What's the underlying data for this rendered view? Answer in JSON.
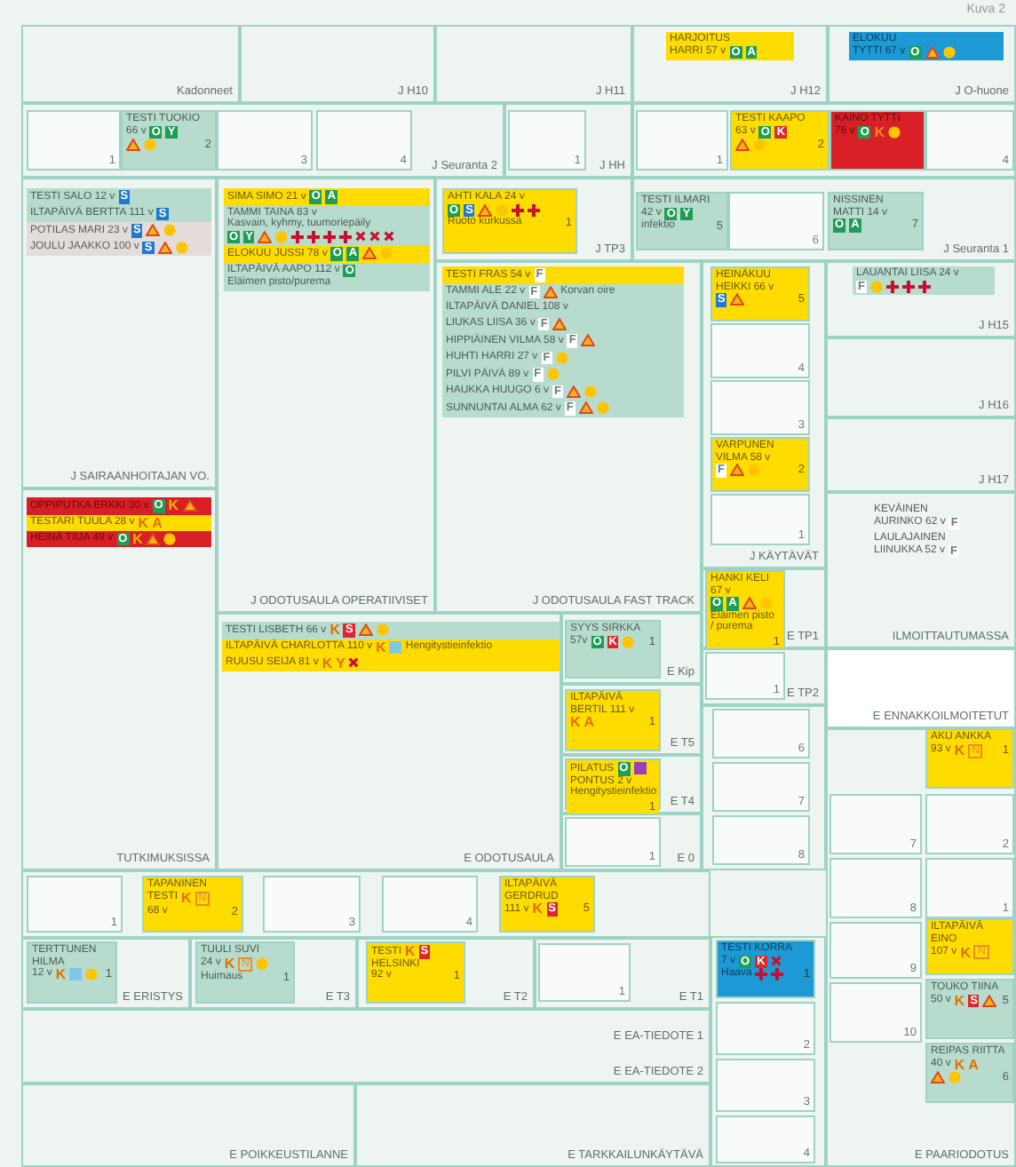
{
  "caption": "Kuva 2",
  "rooms": [
    {
      "label": "Kadonneet"
    },
    {
      "label": "J H10"
    },
    {
      "label": "J H11"
    },
    {
      "label": "J H12",
      "patients": [
        {
          "color": "#ffdc00",
          "lines": [
            [
              {
                "kind": "text",
                "text": "HARJOITUS"
              }
            ],
            [
              {
                "kind": "text",
                "text": "HARRI 57 v"
              },
              {
                "kind": "tag",
                "text": "O",
                "color": "#1f9d55"
              },
              {
                "kind": "tag",
                "text": "A",
                "color": "#1f9d55"
              }
            ]
          ]
        }
      ]
    },
    {
      "label": "J O-huone",
      "patients": [
        {
          "color": "#1d9ad6",
          "lines": [
            [
              {
                "kind": "text",
                "text": "ELOKUU"
              }
            ],
            [
              {
                "kind": "text",
                "text": "TYTTI 67 v"
              },
              {
                "kind": "tag",
                "text": "O",
                "color": "#1f9d55"
              },
              {
                "kind": "warning"
              },
              {
                "kind": "dot"
              }
            ]
          ]
        }
      ]
    },
    {
      "label": "J Seuranta 2",
      "beds": [
        {
          "number": "1"
        },
        {
          "number": "2",
          "patient": {
            "color": "#b7dccd",
            "lines": [
              [
                {
                  "kind": "text",
                  "text": "TESTI TUOKIO"
                }
              ],
              [
                {
                  "kind": "text",
                  "text": "66 v"
                },
                {
                  "kind": "tag",
                  "text": "O",
                  "color": "#1f9d55"
                },
                {
                  "kind": "tag",
                  "text": "Y",
                  "color": "#1f9d55"
                }
              ],
              [
                {
                  "kind": "warning"
                },
                {
                  "kind": "dot"
                }
              ]
            ]
          }
        },
        {
          "number": "3"
        },
        {
          "number": "4"
        }
      ]
    },
    {
      "label": "J HH",
      "beds": [
        {
          "number": "1"
        }
      ]
    },
    {
      "beds": [
        {
          "number": "1"
        },
        {
          "number": "2",
          "patient": {
            "color": "#ffdc00",
            "lines": [
              [
                {
                  "kind": "text",
                  "text": "TESTI KAAPO"
                }
              ],
              [
                {
                  "kind": "text",
                  "text": "63 v"
                },
                {
                  "kind": "tag",
                  "text": "O",
                  "color": "#1f9d55"
                },
                {
                  "kind": "tag",
                  "text": "K",
                  "color": "#e0262b"
                }
              ],
              [
                {
                  "kind": "warning"
                },
                {
                  "kind": "dot"
                }
              ]
            ]
          }
        },
        {
          "patient": {
            "color": "#d91f26",
            "lines": [
              [
                {
                  "kind": "text",
                  "text": "KAINO TYTTI"
                }
              ],
              [
                {
                  "kind": "text",
                  "text": "76 v"
                },
                {
                  "kind": "tag",
                  "text": "O",
                  "color": "#1f9d55"
                },
                {
                  "kind": "letter",
                  "text": "K",
                  "color": "#f08a24"
                },
                {
                  "kind": "dot"
                }
              ]
            ]
          }
        },
        {
          "number": "4"
        }
      ]
    },
    {
      "label": "J SAIRAANHOITAJAN VO.",
      "patients": [
        {
          "color": "#b7dccd",
          "lines": [
            [
              {
                "kind": "text",
                "text": "TESTI SALO 12 v"
              },
              {
                "kind": "tag",
                "text": "S",
                "color": "#1f78d1"
              }
            ]
          ]
        },
        {
          "color": "#b7dccd",
          "lines": [
            [
              {
                "kind": "text",
                "text": "ILTAPÄIVÄ BERTTA 111 v"
              },
              {
                "kind": "tag",
                "text": "S",
                "color": "#1f78d1"
              }
            ]
          ]
        },
        {
          "color": "#e4dcd9",
          "lines": [
            [
              {
                "kind": "text",
                "text": "POTILAS MARI 23 v"
              },
              {
                "kind": "tag",
                "text": "S",
                "color": "#1f78d1"
              },
              {
                "kind": "warning"
              },
              {
                "kind": "dot"
              }
            ]
          ]
        },
        {
          "color": "#e4dcd9",
          "lines": [
            [
              {
                "kind": "text",
                "text": "JOULU JAAKKO 100 v"
              },
              {
                "kind": "tag",
                "text": "S",
                "color": "#1f78d1"
              },
              {
                "kind": "warning"
              },
              {
                "kind": "dot"
              }
            ]
          ]
        }
      ]
    },
    {
      "label": "J ODOTUSAULA OPERATIIVISET",
      "patients": [
        {
          "color": "#ffdc00",
          "lines": [
            [
              {
                "kind": "text",
                "text": "SIMA SIMO 21 v"
              },
              {
                "kind": "tag",
                "text": "O",
                "color": "#1f9d55"
              },
              {
                "kind": "tag",
                "text": "A",
                "color": "#1f9d55"
              }
            ]
          ]
        },
        {
          "color": "#b7dccd",
          "lines": [
            [
              {
                "kind": "text",
                "text": "TAMMI TAINA 83 v"
              }
            ],
            [
              {
                "kind": "text",
                "text": "Kasvain, kyhmy, tuumoriepäily"
              }
            ],
            [
              {
                "kind": "tag",
                "text": "O",
                "color": "#1f9d55"
              },
              {
                "kind": "tag",
                "text": "Y",
                "color": "#1f9d55"
              },
              {
                "kind": "warning"
              },
              {
                "kind": "dot"
              },
              {
                "kind": "cross"
              },
              {
                "kind": "cross"
              },
              {
                "kind": "cross"
              },
              {
                "kind": "cross"
              },
              {
                "kind": "x"
              },
              {
                "kind": "x"
              },
              {
                "kind": "x"
              }
            ]
          ]
        },
        {
          "color": "#ffdc00",
          "lines": [
            [
              {
                "kind": "text",
                "text": "ELOKUU JUSSI 78 v"
              },
              {
                "kind": "tag",
                "text": "O",
                "color": "#1f9d55"
              },
              {
                "kind": "tag",
                "text": "A",
                "color": "#1f9d55"
              },
              {
                "kind": "warning"
              },
              {
                "kind": "dot"
              }
            ]
          ]
        },
        {
          "color": "#b7dccd",
          "lines": [
            [
              {
                "kind": "text",
                "text": "ILTAPÄIVÄ AAPO 112 v"
              },
              {
                "kind": "tag",
                "text": "O",
                "color": "#1f9d55"
              }
            ],
            [
              {
                "kind": "text",
                "text": "Eläimen pisto/purema"
              }
            ]
          ]
        }
      ]
    },
    {
      "label": "J TP3",
      "beds": [
        {
          "number": "1",
          "patient": {
            "color": "#ffdc00",
            "lines": [
              [
                {
                  "kind": "text",
                  "text": "AHTI KALA 24 v"
                }
              ],
              [
                {
                  "kind": "tag",
                  "text": "O",
                  "color": "#1f9d55"
                },
                {
                  "kind": "tag",
                  "text": "S",
                  "color": "#1f78d1"
                },
                {
                  "kind": "warning"
                },
                {
                  "kind": "dot"
                },
                {
                  "kind": "cross"
                },
                {
                  "kind": "cross"
                }
              ],
              [
                {
                  "kind": "text",
                  "text": "Ruoto kurkussa"
                }
              ]
            ]
          }
        }
      ]
    },
    {
      "label": "J Seuranta 1",
      "beds": [
        {
          "number": "5",
          "patient": {
            "color": "#b7dccd",
            "lines": [
              [
                {
                  "kind": "text",
                  "text": "TESTI ILMARI"
                }
              ],
              [
                {
                  "kind": "text",
                  "text": "42 v"
                },
                {
                  "kind": "tag",
                  "text": "O",
                  "color": "#1f9d55"
                },
                {
                  "kind": "tag",
                  "text": "Y",
                  "color": "#1f9d55"
                }
              ],
              [
                {
                  "kind": "text",
                  "text": "infektio"
                }
              ]
            ]
          }
        },
        {
          "number": "6"
        },
        {
          "number": "7",
          "patient": {
            "color": "#b7dccd",
            "lines": [
              [
                {
                  "kind": "text",
                  "text": "NISSINEN"
                }
              ],
              [
                {
                  "kind": "text",
                  "text": "MATTI 14 v"
                }
              ],
              [
                {
                  "kind": "tag",
                  "text": "O",
                  "color": "#1f9d55"
                },
                {
                  "kind": "tag",
                  "text": "A",
                  "color": "#1f9d55"
                }
              ]
            ]
          }
        }
      ]
    },
    {
      "label": "J ODOTUSAULA FAST TRACK",
      "patients": [
        {
          "color": "#ffdc00",
          "lines": [
            [
              {
                "kind": "text",
                "text": "TESTI FRAS 54 v"
              },
              {
                "kind": "tag",
                "text": "F",
                "color": "#ffffff"
              }
            ]
          ]
        },
        {
          "color": "#b7dccd",
          "lines": [
            [
              {
                "kind": "text",
                "text": "TAMMI ALE 22 v"
              },
              {
                "kind": "tag",
                "text": "F",
                "color": "#ffffff"
              },
              {
                "kind": "warning"
              },
              {
                "kind": "text",
                "text": "Korvan oire"
              }
            ]
          ]
        },
        {
          "color": "#b7dccd",
          "lines": [
            [
              {
                "kind": "text",
                "text": "ILTAPÄIVÄ DANIEL 108 v"
              }
            ]
          ]
        },
        {
          "color": "#b7dccd",
          "lines": [
            [
              {
                "kind": "text",
                "text": "LIUKAS LIISA 36 v"
              },
              {
                "kind": "tag",
                "text": "F",
                "color": "#ffffff"
              },
              {
                "kind": "warning"
              }
            ]
          ]
        },
        {
          "color": "#b7dccd",
          "lines": [
            [
              {
                "kind": "text",
                "text": "HIPPIÄINEN VILMA 58 v"
              },
              {
                "kind": "tag",
                "text": "F",
                "color": "#ffffff"
              },
              {
                "kind": "warning"
              }
            ]
          ]
        },
        {
          "color": "#b7dccd",
          "lines": [
            [
              {
                "kind": "text",
                "text": "HUHTI HARRI 27 v"
              },
              {
                "kind": "tag",
                "text": "F",
                "color": "#ffffff"
              },
              {
                "kind": "dot"
              }
            ]
          ]
        },
        {
          "color": "#b7dccd",
          "lines": [
            [
              {
                "kind": "text",
                "text": "PILVI PÄIVÄ 89 v"
              },
              {
                "kind": "tag",
                "text": "F",
                "color": "#ffffff"
              },
              {
                "kind": "dot"
              }
            ]
          ]
        },
        {
          "color": "#b7dccd",
          "lines": [
            [
              {
                "kind": "text",
                "text": "HAUKKA HUUGO 6 v"
              },
              {
                "kind": "tag",
                "text": "F",
                "color": "#ffffff"
              },
              {
                "kind": "warning"
              },
              {
                "kind": "dot"
              }
            ]
          ]
        },
        {
          "color": "#b7dccd",
          "lines": [
            [
              {
                "kind": "text",
                "text": "SUNNUNTAI ALMA 62 v"
              },
              {
                "kind": "tag",
                "text": "F",
                "color": "#ffffff"
              },
              {
                "kind": "warning"
              },
              {
                "kind": "dot"
              }
            ]
          ]
        }
      ]
    },
    {
      "label": "J KÄYTÄVÄT",
      "beds": [
        {
          "number": "5",
          "patient": {
            "color": "#ffdc00",
            "lines": [
              [
                {
                  "kind": "text",
                  "text": "HEINÄKUU"
                }
              ],
              [
                {
                  "kind": "text",
                  "text": "HEIKKI 66 v"
                }
              ],
              [
                {
                  "kind": "tag",
                  "text": "S",
                  "color": "#1f78d1"
                },
                {
                  "kind": "warning"
                }
              ]
            ]
          }
        },
        {
          "number": "4"
        },
        {
          "number": "3"
        },
        {
          "number": "2",
          "patient": {
            "color": "#ffdc00",
            "lines": [
              [
                {
                  "kind": "text",
                  "text": "VARPUNEN"
                }
              ],
              [
                {
                  "kind": "text",
                  "text": "VILMA 58 v"
                }
              ],
              [
                {
                  "kind": "tag",
                  "text": "F",
                  "color": "#ffffff"
                },
                {
                  "kind": "warning"
                },
                {
                  "kind": "dot"
                }
              ]
            ]
          }
        },
        {
          "number": "1"
        }
      ]
    },
    {
      "label": "J H15",
      "patients": [
        {
          "color": "#b7dccd",
          "lines": [
            [
              {
                "kind": "text",
                "text": "LAUANTAI LIISA 24 v"
              }
            ],
            [
              {
                "kind": "tag",
                "text": "F",
                "color": "#ffffff"
              },
              {
                "kind": "dot"
              },
              {
                "kind": "cross"
              },
              {
                "kind": "cross"
              },
              {
                "kind": "cross"
              }
            ]
          ]
        }
      ]
    },
    {
      "label": "J H16"
    },
    {
      "label": "J H17"
    },
    {
      "label": "ILMOITTAUTUMASSA",
      "patients": [
        {
          "lines": [
            [
              {
                "kind": "text",
                "text": "KEVÄINEN"
              }
            ],
            [
              {
                "kind": "text",
                "text": "AURINKO 62 v"
              },
              {
                "kind": "tag",
                "text": "F",
                "color": "#ffffff"
              }
            ]
          ]
        },
        {
          "lines": [
            [
              {
                "kind": "text",
                "text": "LAULAJAINEN"
              }
            ],
            [
              {
                "kind": "text",
                "text": "LIINUKKA 52 v"
              },
              {
                "kind": "tag",
                "text": "F",
                "color": "#ffffff"
              }
            ]
          ]
        }
      ]
    },
    {
      "label": "E ENNAKKOILMOITETUT"
    },
    {
      "label": "TUTKIMUKSISSA",
      "patients": [
        {
          "color": "#d91f26",
          "lines": [
            [
              {
                "kind": "text",
                "text": "OPPIPUTKA ERKKI 30 v"
              },
              {
                "kind": "tag",
                "text": "O",
                "color": "#1f9d55"
              },
              {
                "kind": "letter",
                "text": "K",
                "color": "#f0b400"
              },
              {
                "kind": "warning"
              }
            ]
          ]
        },
        {
          "color": "#ffdc00",
          "lines": [
            [
              {
                "kind": "text",
                "text": "TESTARI TUULA 28 v"
              },
              {
                "kind": "letter",
                "text": "K",
                "color": "#e07000"
              },
              {
                "kind": "letter",
                "text": "A",
                "color": "#e07000"
              }
            ]
          ]
        },
        {
          "color": "#d91f26",
          "lines": [
            [
              {
                "kind": "text",
                "text": "HEINÄ TIIJA 49 v"
              },
              {
                "kind": "tag",
                "text": "O",
                "color": "#1f9d55"
              },
              {
                "kind": "letter",
                "text": "K",
                "color": "#f0b400"
              },
              {
                "kind": "warning"
              },
              {
                "kind": "dot"
              }
            ]
          ]
        }
      ]
    },
    {
      "label": "E ODOTUSAULA",
      "patients": [
        {
          "color": "#b7dccd",
          "lines": [
            [
              {
                "kind": "text",
                "text": "TESTI LISBETH 66 v"
              },
              {
                "kind": "letter",
                "text": "K",
                "color": "#e07000"
              },
              {
                "kind": "tag",
                "text": "S",
                "color": "#e0262b"
              },
              {
                "kind": "warning"
              },
              {
                "kind": "dot"
              }
            ]
          ]
        },
        {
          "color": "#ffdc00",
          "lines": [
            [
              {
                "kind": "text",
                "text": "ILTAPÄIVÄ CHARLOTTA 110 v"
              },
              {
                "kind": "letter",
                "text": "K",
                "color": "#e07000"
              },
              {
                "kind": "square",
                "color": "#7fc8e8"
              },
              {
                "kind": "text",
                "text": "Hengitystieinfektio"
              }
            ]
          ]
        },
        {
          "color": "#ffdc00",
          "lines": [
            [
              {
                "kind": "text",
                "text": "RUUSU SEIJA 81 v"
              },
              {
                "kind": "letter",
                "text": "K",
                "color": "#e07000"
              },
              {
                "kind": "letter",
                "text": "Y",
                "color": "#e07000"
              },
              {
                "kind": "x"
              }
            ]
          ]
        }
      ]
    },
    {
      "label": "E Kip",
      "beds": [
        {
          "number": "1",
          "patient": {
            "color": "#b7dccd",
            "lines": [
              [
                {
                  "kind": "text",
                  "text": "SYYS SIRKKA"
                }
              ],
              [
                {
                  "kind": "text",
                  "text": "57v"
                },
                {
                  "kind": "tag",
                  "text": "O",
                  "color": "#1f9d55"
                },
                {
                  "kind": "tag",
                  "text": "K",
                  "color": "#e0262b"
                },
                {
                  "kind": "dot"
                }
              ]
            ]
          }
        }
      ]
    },
    {
      "label": "E T5",
      "beds": [
        {
          "number": "1",
          "patient": {
            "color": "#ffdc00",
            "lines": [
              [
                {
                  "kind": "text",
                  "text": "ILTAPÄIVÄ"
                }
              ],
              [
                {
                  "kind": "text",
                  "text": "BERTIL 111 v"
                }
              ],
              [
                {
                  "kind": "letter",
                  "text": "K",
                  "color": "#e07000"
                },
                {
                  "kind": "letter",
                  "text": "A",
                  "color": "#e07000"
                }
              ]
            ]
          }
        }
      ]
    },
    {
      "label": "E T4",
      "beds": [
        {
          "number": "1",
          "patient": {
            "color": "#ffdc00",
            "lines": [
              [
                {
                  "kind": "text",
                  "text": "PILATUS"
                },
                {
                  "kind": "tag",
                  "text": "O",
                  "color": "#1f9d55"
                },
                {
                  "kind": "square",
                  "color": "#9b3fb5"
                }
              ],
              [
                {
                  "kind": "text",
                  "text": "PONTUS 2 v"
                }
              ],
              [
                {
                  "kind": "text",
                  "text": "Hengitystieinfektio"
                }
              ]
            ]
          }
        }
      ]
    },
    {
      "label": "E 0",
      "beds": [
        {
          "number": "1"
        }
      ]
    },
    {
      "label": "E TP1",
      "beds": [
        {
          "number": "1",
          "patient": {
            "color": "#ffdc00",
            "lines": [
              [
                {
                  "kind": "text",
                  "text": "HANKI KELI 67 v"
                }
              ],
              [
                {
                  "kind": "tag",
                  "text": "O",
                  "color": "#1f9d55"
                },
                {
                  "kind": "tag",
                  "text": "A",
                  "color": "#1f9d55"
                },
                {
                  "kind": "warning"
                },
                {
                  "kind": "dot"
                }
              ],
              [
                {
                  "kind": "text",
                  "text": "Eläimen pisto / purema"
                }
              ]
            ]
          }
        }
      ]
    },
    {
      "label": "E TP2",
      "beds": [
        {
          "number": "1"
        }
      ]
    },
    {
      "beds": [
        {
          "number": "6"
        },
        {
          "number": "7"
        },
        {
          "number": "8"
        }
      ]
    },
    {
      "beds": [
        {
          "number": "1"
        },
        {
          "number": "2",
          "patient": {
            "color": "#ffdc00",
            "lines": [
              [
                {
                  "kind": "text",
                  "text": "TAPANINEN"
                }
              ],
              [
                {
                  "kind": "text",
                  "text": "TESTI"
                },
                {
                  "kind": "letter",
                  "text": "K",
                  "color": "#e07000"
                },
                {
                  "kind": "outline",
                  "text": "N",
                  "color": "#f08a24"
                }
              ],
              [
                {
                  "kind": "text",
                  "text": "68 v"
                }
              ]
            ]
          }
        },
        {
          "number": "3"
        },
        {
          "number": "4"
        },
        {
          "number": "5",
          "patient": {
            "color": "#ffdc00",
            "lines": [
              [
                {
                  "kind": "text",
                  "text": "ILTAPÄIVÄ"
                }
              ],
              [
                {
                  "kind": "text",
                  "text": "GERDRUD"
                }
              ],
              [
                {
                  "kind": "text",
                  "text": "111 v"
                },
                {
                  "kind": "letter",
                  "text": "K",
                  "color": "#e07000"
                },
                {
                  "kind": "tag",
                  "text": "S",
                  "color": "#e0262b"
                }
              ]
            ]
          }
        }
      ]
    },
    {
      "label": "E ERISTYS",
      "beds": [
        {
          "number": "1",
          "patient": {
            "color": "#b7dccd",
            "lines": [
              [
                {
                  "kind": "text",
                  "text": "TERTTUNEN"
                }
              ],
              [
                {
                  "kind": "text",
                  "text": "HILMA"
                }
              ],
              [
                {
                  "kind": "text",
                  "text": "12 v"
                },
                {
                  "kind": "letter",
                  "text": "K",
                  "color": "#e07000"
                },
                {
                  "kind": "square",
                  "color": "#7fc8e8"
                },
                {
                  "kind": "dot"
                }
              ]
            ]
          }
        }
      ]
    },
    {
      "label": "E T3",
      "beds": [
        {
          "number": "1",
          "patient": {
            "color": "#b7dccd",
            "lines": [
              [
                {
                  "kind": "text",
                  "text": "TUULI SUVI"
                }
              ],
              [
                {
                  "kind": "text",
                  "text": "24 v"
                },
                {
                  "kind": "letter",
                  "text": "K",
                  "color": "#e07000"
                },
                {
                  "kind": "outline",
                  "text": "N",
                  "color": "#f08a24"
                },
                {
                  "kind": "dot"
                }
              ],
              [
                {
                  "kind": "text",
                  "text": "Huimaus"
                }
              ]
            ]
          }
        }
      ]
    },
    {
      "label": "E T2",
      "beds": [
        {
          "number": "1",
          "patient": {
            "color": "#ffdc00",
            "lines": [
              [
                {
                  "kind": "text",
                  "text": "TESTI"
                },
                {
                  "kind": "letter",
                  "text": "K",
                  "color": "#e07000"
                },
                {
                  "kind": "tag",
                  "text": "S",
                  "color": "#e0262b"
                }
              ],
              [
                {
                  "kind": "text",
                  "text": "HELSINKI"
                }
              ],
              [
                {
                  "kind": "text",
                  "text": "92 v"
                }
              ]
            ]
          }
        }
      ]
    },
    {
      "label": "E T1",
      "beds": [
        {
          "number": "1"
        }
      ]
    },
    {
      "label": "E EA-TIEDOTE 1"
    },
    {
      "label": "E EA-TIEDOTE 2"
    },
    {
      "label": "E POIKKEUSTILANNE"
    },
    {
      "label": "E TARKKAILUNKÄYTÄVÄ"
    },
    {
      "beds": [
        {
          "number": "1",
          "patient": {
            "color": "#1d9ad6",
            "lines": [
              [
                {
                  "kind": "text",
                  "text": "TESTI KORRA"
                }
              ],
              [
                {
                  "kind": "text",
                  "text": "7 v"
                },
                {
                  "kind": "tag",
                  "text": "O",
                  "color": "#1f9d55"
                },
                {
                  "kind": "tag",
                  "text": "K",
                  "color": "#e0262b"
                },
                {
                  "kind": "x"
                }
              ],
              [
                {
                  "kind": "text",
                  "text": "Haava"
                },
                {
                  "kind": "cross"
                },
                {
                  "kind": "cross"
                }
              ]
            ]
          }
        },
        {
          "number": "2"
        },
        {
          "number": "3"
        },
        {
          "number": "4"
        }
      ]
    },
    {
      "label": "E PAARIODOTUS",
      "beds": [
        {
          "number": "1",
          "patient": {
            "color": "#ffdc00",
            "lines": [
              [
                {
                  "kind": "text",
                  "text": "AKU ANKKA"
                }
              ],
              [
                {
                  "kind": "text",
                  "text": "93 v"
                },
                {
                  "kind": "letter",
                  "text": "K",
                  "color": "#e07000"
                },
                {
                  "kind": "outline",
                  "text": "N",
                  "color": "#f08a24"
                }
              ]
            ]
          }
        },
        {
          "number": "7"
        },
        {
          "number": "2"
        },
        {
          "number": "8"
        },
        {
          "number": "1"
        },
        {
          "number": "9"
        },
        {
          "patient": {
            "color": "#ffdc00",
            "lines": [
              [
                {
                  "kind": "text",
                  "text": "ILTAPÄIVÄ EINO"
                }
              ],
              [
                {
                  "kind": "text",
                  "text": "107 v"
                },
                {
                  "kind": "letter",
                  "text": "K",
                  "color": "#e07000"
                },
                {
                  "kind": "outline",
                  "text": "N",
                  "color": "#f08a24"
                }
              ]
            ]
          }
        },
        {
          "number": "10"
        },
        {
          "number": "5",
          "patient": {
            "color": "#b7dccd",
            "lines": [
              [
                {
                  "kind": "text",
                  "text": "TOUKO TIINA"
                }
              ],
              [
                {
                  "kind": "text",
                  "text": "50 v"
                },
                {
                  "kind": "letter",
                  "text": "K",
                  "color": "#e07000"
                },
                {
                  "kind": "tag",
                  "text": "S",
                  "color": "#e0262b"
                },
                {
                  "kind": "warning"
                }
              ]
            ]
          }
        },
        {
          "number": "6",
          "patient": {
            "color": "#b7dccd",
            "lines": [
              [
                {
                  "kind": "text",
                  "text": "REIPAS RIITTA"
                }
              ],
              [
                {
                  "kind": "text",
                  "text": "40 v"
                },
                {
                  "kind": "letter",
                  "text": "K",
                  "color": "#e07000"
                },
                {
                  "kind": "letter",
                  "text": "A",
                  "color": "#e07000"
                }
              ],
              [
                {
                  "kind": "warning"
                },
                {
                  "kind": "dot"
                }
              ]
            ]
          }
        }
      ]
    }
  ]
}
